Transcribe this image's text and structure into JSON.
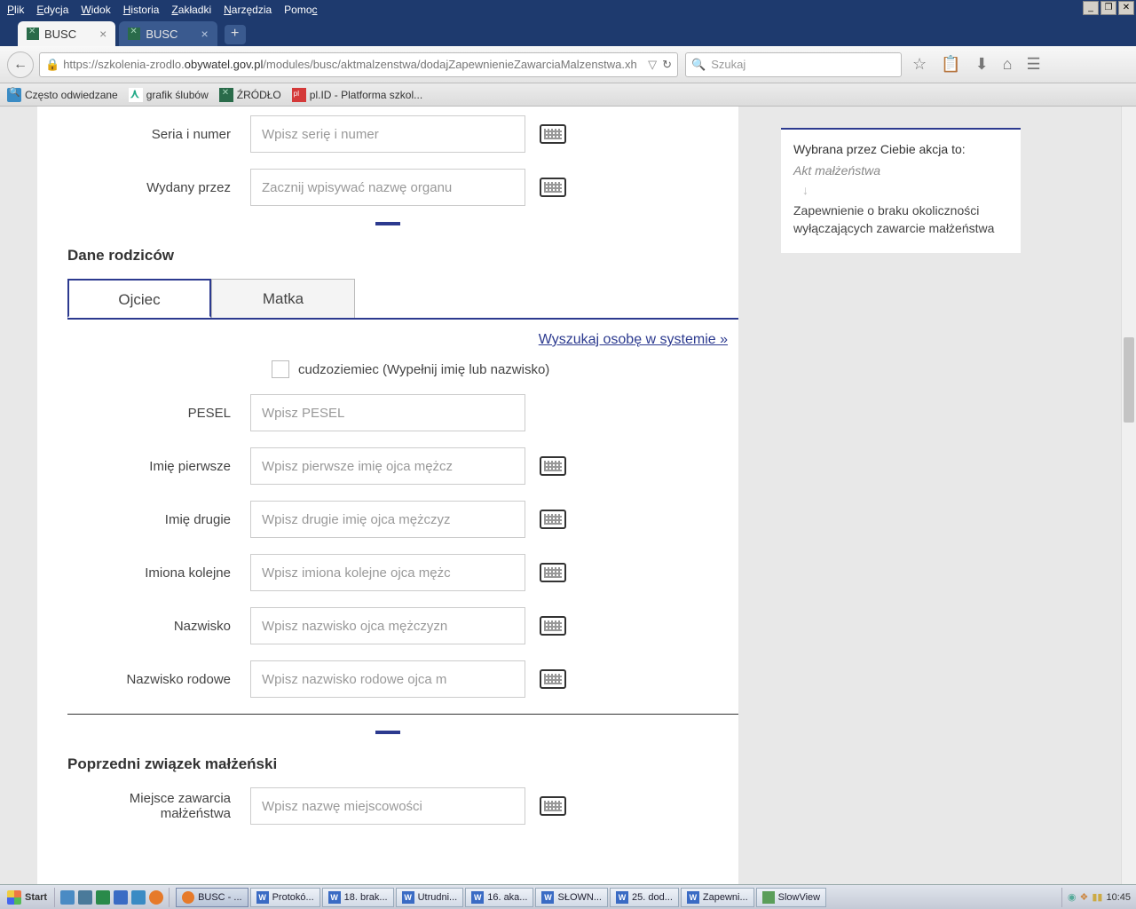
{
  "menubar": {
    "items": [
      "Plik",
      "Edycja",
      "Widok",
      "Historia",
      "Zakładki",
      "Narzędzia",
      "Pomoc"
    ]
  },
  "tabs": {
    "tab1": "BUSC",
    "tab2": "BUSC"
  },
  "url": {
    "prefix": "https://szkolenia-zrodlo.",
    "host": "obywatel.gov.pl",
    "path": "/modules/busc/aktmalzenstwa/dodajZapewnienieZawarciaMalzenstwa.xh"
  },
  "search": {
    "placeholder": "Szukaj"
  },
  "bookmarks": {
    "b1": "Często odwiedzane",
    "b2": "grafik ślubów",
    "b3": "ŹRÓDŁO",
    "b4": "pl.ID - Platforma szkol..."
  },
  "sidebar": {
    "heading": "Wybrana przez Ciebie akcja to:",
    "breadcrumb": "Akt małżeństwa",
    "current": "Zapewnienie o braku okoliczności wyłączających zawarcie małżeństwa"
  },
  "form": {
    "seria_label": "Seria i numer",
    "seria_ph": "Wpisz serię i numer",
    "wydany_label": "Wydany przez",
    "wydany_ph": "Zacznij wpisywać nazwę organu",
    "section_rodzicow": "Dane rodziców",
    "tab_ojciec": "Ojciec",
    "tab_matka": "Matka",
    "search_link": "Wyszukaj osobę w systemie »",
    "cudzo_label": "cudzoziemiec (Wypełnij imię lub nazwisko)",
    "pesel_label": "PESEL",
    "pesel_ph": "Wpisz PESEL",
    "imie1_label": "Imię pierwsze",
    "imie1_ph": "Wpisz pierwsze imię ojca mężcz",
    "imie2_label": "Imię drugie",
    "imie2_ph": "Wpisz drugie imię ojca mężczyz",
    "imiona_label": "Imiona kolejne",
    "imiona_ph": "Wpisz imiona kolejne ojca mężc",
    "nazwisko_label": "Nazwisko",
    "nazwisko_ph": "Wpisz nazwisko ojca mężczyzn",
    "nazrod_label": "Nazwisko rodowe",
    "nazrod_ph": "Wpisz nazwisko rodowe ojca m",
    "section_poprzedni": "Poprzedni związek małżeński",
    "miejsce_label_l1": "Miejsce zawarcia",
    "miejsce_label_l2": "małżeństwa",
    "miejsce_ph": "Wpisz nazwę miejscowości"
  },
  "taskbar": {
    "start": "Start",
    "tasks": [
      {
        "icon": "ff",
        "label": "BUSC - ..."
      },
      {
        "icon": "word",
        "label": "Protokó..."
      },
      {
        "icon": "word",
        "label": "18. brak..."
      },
      {
        "icon": "word",
        "label": "Utrudni..."
      },
      {
        "icon": "word",
        "label": "16. aka..."
      },
      {
        "icon": "word",
        "label": "SŁOWN..."
      },
      {
        "icon": "word",
        "label": "25. dod..."
      },
      {
        "icon": "word",
        "label": "Zapewni..."
      },
      {
        "icon": "sv",
        "label": "SlowView"
      }
    ],
    "clock": "10:45"
  }
}
